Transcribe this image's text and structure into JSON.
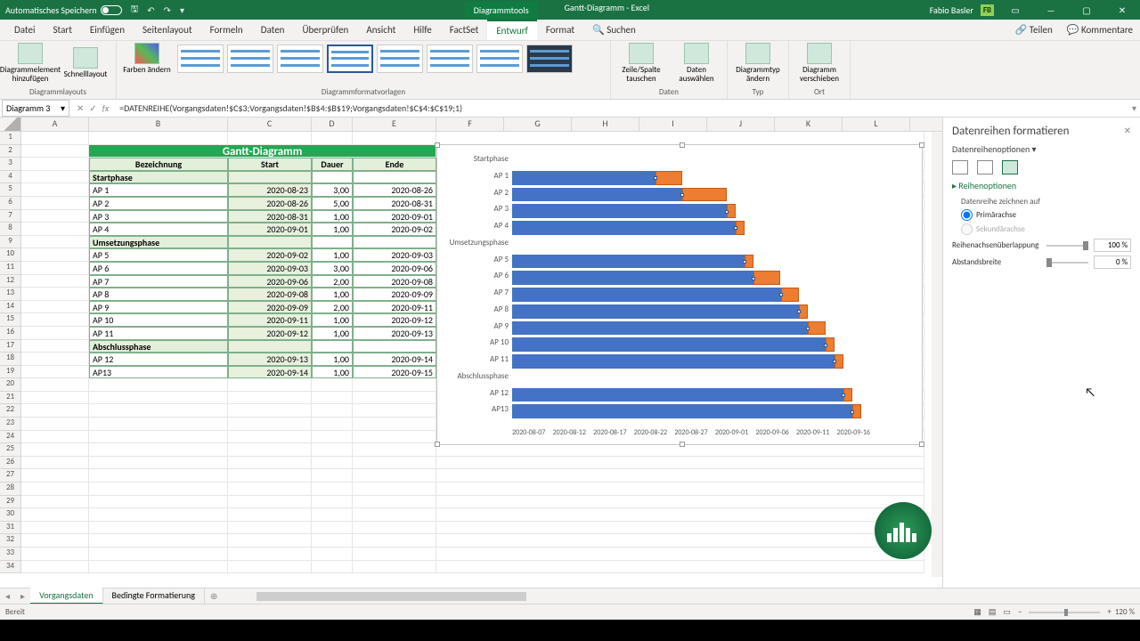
{
  "titlebar": {
    "autosave": "Automatisches Speichern",
    "tools": "Diagrammtools",
    "doc": "Gantt-Diagramm - Excel",
    "user": "Fabio Basler",
    "badge": "FB"
  },
  "tabs": [
    "Datei",
    "Start",
    "Einfügen",
    "Seitenlayout",
    "Formeln",
    "Daten",
    "Überprüfen",
    "Ansicht",
    "Hilfe",
    "FactSet",
    "Entwurf",
    "Format"
  ],
  "active_tab": "Entwurf",
  "search": "Suchen",
  "share": "Teilen",
  "comments": "Kommentare",
  "ribbon": {
    "layouts": "Diagrammlayouts",
    "add_element": "Diagrammelement hinzufügen",
    "quick_layout": "Schnelllayout",
    "colors": "Farben ändern",
    "styles": "Diagrammformatvorlagen",
    "daten": "Daten",
    "zeile_spalte": "Zeile/Spalte tauschen",
    "daten_auswahl": "Daten auswählen",
    "typ": "Typ",
    "typ_aendern": "Diagrammtyp ändern",
    "ort": "Ort",
    "verschieben": "Diagramm verschieben"
  },
  "namebox": "Diagramm 3",
  "formula": "=DATENREIHE(Vorgangsdaten!$C$3;Vorgangsdaten!$B$4:$B$19;Vorgangsdaten!$C$4:$C$19;1)",
  "cols": [
    "A",
    "B",
    "C",
    "D",
    "E",
    "F",
    "G",
    "H",
    "I",
    "J",
    "K",
    "L"
  ],
  "table": {
    "title": "Gantt-Diagramm",
    "headers": [
      "Bezeichnung",
      "Start",
      "Dauer",
      "Ende"
    ],
    "rows": [
      {
        "r": 4,
        "b": "Startphase",
        "phase": true
      },
      {
        "r": 5,
        "b": "AP 1",
        "c": "2020-08-23",
        "d": "3,00",
        "e": "2020-08-26"
      },
      {
        "r": 6,
        "b": "AP 2",
        "c": "2020-08-26",
        "d": "5,00",
        "e": "2020-08-31"
      },
      {
        "r": 7,
        "b": "AP 3",
        "c": "2020-08-31",
        "d": "1,00",
        "e": "2020-09-01"
      },
      {
        "r": 8,
        "b": "AP 4",
        "c": "2020-09-01",
        "d": "1,00",
        "e": "2020-09-02"
      },
      {
        "r": 9,
        "b": "Umsetzungsphase",
        "phase": true
      },
      {
        "r": 10,
        "b": "AP 5",
        "c": "2020-09-02",
        "d": "1,00",
        "e": "2020-09-03"
      },
      {
        "r": 11,
        "b": "AP 6",
        "c": "2020-09-03",
        "d": "3,00",
        "e": "2020-09-06"
      },
      {
        "r": 12,
        "b": "AP 7",
        "c": "2020-09-06",
        "d": "2,00",
        "e": "2020-09-08"
      },
      {
        "r": 13,
        "b": "AP 8",
        "c": "2020-09-08",
        "d": "1,00",
        "e": "2020-09-09"
      },
      {
        "r": 14,
        "b": "AP 9",
        "c": "2020-09-09",
        "d": "2,00",
        "e": "2020-09-11"
      },
      {
        "r": 15,
        "b": "AP 10",
        "c": "2020-09-11",
        "d": "1,00",
        "e": "2020-09-12"
      },
      {
        "r": 16,
        "b": "AP 11",
        "c": "2020-09-12",
        "d": "1,00",
        "e": "2020-09-13"
      },
      {
        "r": 17,
        "b": "Abschlussphase",
        "phase": true
      },
      {
        "r": 18,
        "b": "AP 12",
        "c": "2020-09-13",
        "d": "1,00",
        "e": "2020-09-14"
      },
      {
        "r": 19,
        "b": "AP13",
        "c": "2020-09-14",
        "d": "1,00",
        "e": "2020-09-15"
      }
    ]
  },
  "chart_data": {
    "type": "bar",
    "orientation": "horizontal-stacked",
    "title": "",
    "xlabel": "",
    "ylabel": "",
    "x_ticks": [
      "2020-08-07",
      "2020-08-12",
      "2020-08-17",
      "2020-08-22",
      "2020-08-27",
      "2020-09-01",
      "2020-09-06",
      "2020-09-11",
      "2020-09-16"
    ],
    "xlim": [
      "2020-08-07",
      "2020-09-16"
    ],
    "categories": [
      "Startphase",
      "AP 1",
      "AP 2",
      "AP 3",
      "AP 4",
      "Umsetzungsphase",
      "AP 5",
      "AP 6",
      "AP 7",
      "AP 8",
      "AP 9",
      "AP 10",
      "AP 11",
      "Abschlussphase",
      "AP 12",
      "AP13"
    ],
    "series": [
      {
        "name": "Start",
        "color": "#4472c4",
        "values": [
          null,
          "2020-08-23",
          "2020-08-26",
          "2020-08-31",
          "2020-09-01",
          null,
          "2020-09-02",
          "2020-09-03",
          "2020-09-06",
          "2020-09-08",
          "2020-09-09",
          "2020-09-11",
          "2020-09-12",
          null,
          "2020-09-13",
          "2020-09-14"
        ]
      },
      {
        "name": "Dauer",
        "color": "#ed7d31",
        "values": [
          null,
          3,
          5,
          1,
          1,
          null,
          1,
          3,
          2,
          1,
          2,
          1,
          1,
          null,
          1,
          1
        ]
      }
    ],
    "selected_series": "Start"
  },
  "panel": {
    "title": "Datenreihen formatieren",
    "options": "Datenreihenoptionen",
    "section": "Reihenoptionen",
    "draw_on": "Datenreihe zeichnen auf",
    "primary": "Primärachse",
    "secondary": "Sekundärachse",
    "overlap": "Reihenachsenüberlappung",
    "overlap_val": "100 %",
    "gap": "Abstandsbreite",
    "gap_val": "0 %"
  },
  "sheets": [
    "Vorgangsdaten",
    "Bedingte Formatierung"
  ],
  "active_sheet": "Vorgangsdaten",
  "status": "Bereit",
  "zoom": "120 %"
}
